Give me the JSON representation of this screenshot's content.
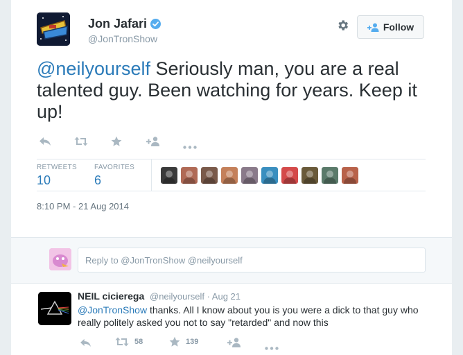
{
  "tweet": {
    "author_name": "Jon Jafari",
    "author_handle": "@JonTronShow",
    "follow_label": "Follow",
    "text_mention": "@neilyourself",
    "text_body": " Seriously man, you are a real talented guy.  Been watching for years.  Keep it up!",
    "stats": {
      "retweets_label": "RETWEETS",
      "retweets_value": "10",
      "favorites_label": "FAVORITES",
      "favorites_value": "6"
    },
    "timestamp": "8:10 PM - 21 Aug 2014"
  },
  "favoriters": [
    {
      "icon": "avatar-1",
      "color": "#3a3a3a"
    },
    {
      "icon": "avatar-2",
      "color": "#b06a56"
    },
    {
      "icon": "avatar-3",
      "color": "#7a5a4a"
    },
    {
      "icon": "avatar-4",
      "color": "#c4805a"
    },
    {
      "icon": "avatar-5",
      "color": "#8a7a8a"
    },
    {
      "icon": "avatar-6",
      "color": "#3a8fbf"
    },
    {
      "icon": "avatar-7",
      "color": "#d44a4a"
    },
    {
      "icon": "avatar-8",
      "color": "#6a5a3a"
    },
    {
      "icon": "avatar-9",
      "color": "#5a7a6a"
    },
    {
      "icon": "avatar-10",
      "color": "#b8624a"
    }
  ],
  "reply_box": {
    "placeholder": "Reply to @JonTronShow @neilyourself"
  },
  "reply": {
    "author_name": "NEIL cicierega",
    "author_handle": "@neilyourself",
    "separator": " · ",
    "date": "Aug 21",
    "text_mention": "@JonTronShow",
    "text_body": " thanks. All I know about you is you were a dick to that guy who really politely asked you not to say \"retarded\" and now this",
    "retweet_count": "58",
    "favorite_count": "139"
  },
  "colors": {
    "link": "#2b7bb9",
    "verified": "#55acee",
    "muted": "#8899a6"
  }
}
